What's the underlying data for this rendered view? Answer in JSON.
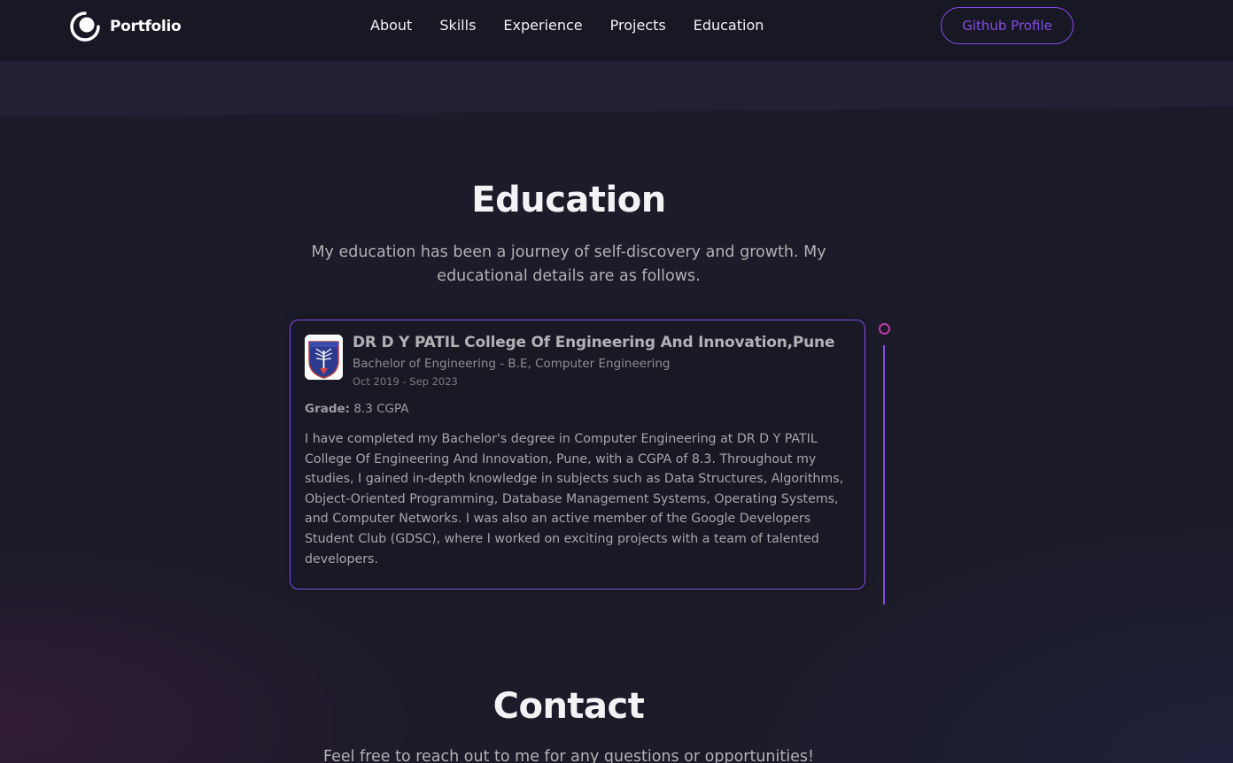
{
  "nav": {
    "logo_text": "Portfolio",
    "links": [
      "About",
      "Skills",
      "Experience",
      "Projects",
      "Education"
    ],
    "github_button": "Github Profile"
  },
  "education": {
    "title": "Education",
    "description": "My education has been a journey of self-discovery and growth. My educational details are as follows.",
    "entries": [
      {
        "school": "DR D Y PATIL College Of Engineering And Innovation,Pune",
        "degree": "Bachelor of Engineering - B.E, Computer Engineering",
        "dates": "Oct 2019 - Sep 2023",
        "grade_label": "Grade:",
        "grade_value": "8.3 CGPA",
        "description": "I have completed my Bachelor's degree in Computer Engineering at DR D Y PATIL College Of Engineering And Innovation, Pune, with a CGPA of 8.3. Throughout my studies, I gained in-depth knowledge in subjects such as Data Structures, Algorithms, Object-Oriented Programming, Database Management Systems, Operating Systems, and Computer Networks. I was also an active member of the Google Developers Student Club (GDSC), where I worked on exciting projects with a team of talented developers."
      }
    ]
  },
  "contact": {
    "title": "Contact",
    "description": "Feel free to reach out to me for any questions or opportunities!"
  },
  "colors": {
    "background": "#1c1b29",
    "navbar": "#181724",
    "accent": "#854ce6",
    "timeline_dot": "#c13aa7",
    "text_primary": "#f2f3f4",
    "text_secondary": "#b1b2b3"
  },
  "icons": {
    "logo": "portfolio-logo-icon",
    "school": "college-crest-icon"
  }
}
